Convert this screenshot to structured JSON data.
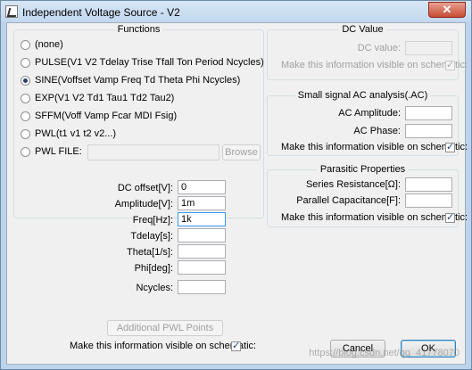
{
  "window": {
    "title": "Independent Voltage Source - V2",
    "close_glyph": "✕"
  },
  "functions": {
    "title": "Functions",
    "options": [
      {
        "label": "(none)",
        "selected": false
      },
      {
        "label": "PULSE(V1 V2 Tdelay Trise Tfall Ton Period Ncycles)",
        "selected": false
      },
      {
        "label": "SINE(Voffset Vamp Freq Td Theta Phi Ncycles)",
        "selected": true
      },
      {
        "label": "EXP(V1 V2 Td1 Tau1 Td2 Tau2)",
        "selected": false
      },
      {
        "label": "SFFM(Voff Vamp Fcar MDI Fsig)",
        "selected": false
      },
      {
        "label": "PWL(t1 v1 t2 v2...)",
        "selected": false
      },
      {
        "label": "PWL FILE:",
        "selected": false
      }
    ],
    "pwl_file_value": "",
    "browse_label": "Browse"
  },
  "sine_params": [
    {
      "label": "DC offset[V]:",
      "value": "0"
    },
    {
      "label": "Amplitude[V]:",
      "value": "1m"
    },
    {
      "label": "Freq[Hz]:",
      "value": "1k"
    },
    {
      "label": "Tdelay[s]:",
      "value": ""
    },
    {
      "label": "Theta[1/s]:",
      "value": ""
    },
    {
      "label": "Phi[deg]:",
      "value": ""
    },
    {
      "label": "Ncycles:",
      "value": ""
    }
  ],
  "additional_pwl_label": "Additional PWL Points",
  "left_visible_label": "Make this information visible on schematic:",
  "left_visible_checked": true,
  "dc_value": {
    "title": "DC Value",
    "dc_label": "DC value:",
    "dc_value": "",
    "visible_label": "Make this information visible on schematic:",
    "visible_checked": true
  },
  "ac_analysis": {
    "title": "Small signal AC analysis(.AC)",
    "amplitude_label": "AC Amplitude:",
    "amplitude_value": "",
    "phase_label": "AC Phase:",
    "phase_value": "",
    "visible_label": "Make this information visible on schematic:",
    "visible_checked": true
  },
  "parasitic": {
    "title": "Parasitic Properties",
    "series_label": "Series Resistance[Ω]:",
    "series_value": "",
    "parallel_label": "Parallel Capacitance[F]:",
    "parallel_value": "",
    "visible_label": "Make this information visible on schematic:",
    "visible_checked": true
  },
  "buttons": {
    "cancel": "Cancel",
    "ok": "OK"
  },
  "watermark": "https://blog.csdn.net/qq_41778070"
}
